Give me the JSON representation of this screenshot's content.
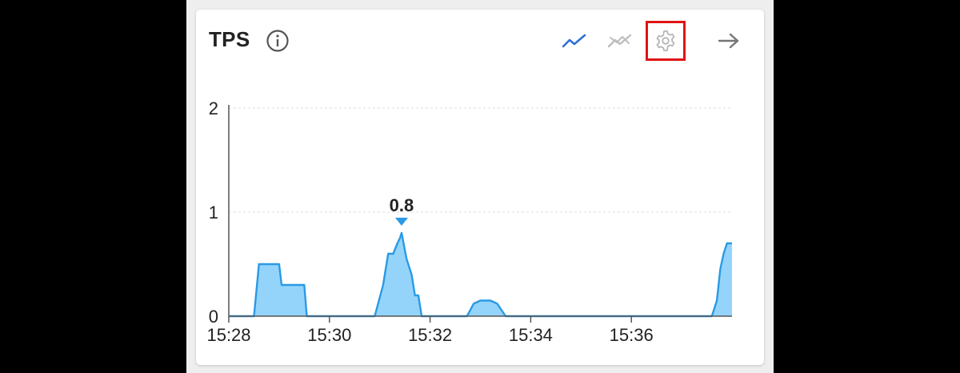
{
  "panel": {
    "title": "TPS",
    "icons": {
      "info": "info-circle-icon",
      "line_mode": "trend-line-icon",
      "compare_mode": "trend-compare-icon",
      "settings": "gear-icon",
      "open": "arrow-right-icon"
    },
    "colors": {
      "active_icon": "#2f6fd6",
      "inactive_icon": "#bdbdbd",
      "settings_highlight": "#e01414",
      "series_stroke": "#2a9ae6",
      "series_fill": "#8fd2fa"
    }
  },
  "chart_data": {
    "type": "area",
    "title": "",
    "xlabel": "",
    "ylabel": "",
    "ylim": [
      0,
      2
    ],
    "yticks": [
      "0",
      "1",
      "2"
    ],
    "xticks": [
      "15:28",
      "15:30",
      "15:32",
      "15:34",
      "15:36"
    ],
    "grid": true,
    "peak_label": "0.8",
    "series": [
      {
        "points": [
          [
            "15:28:00",
            0
          ],
          [
            "15:28:30",
            0
          ],
          [
            "15:28:36",
            0.5
          ],
          [
            "15:29:00",
            0.5
          ],
          [
            "15:29:03",
            0.3
          ],
          [
            "15:29:30",
            0.3
          ],
          [
            "15:29:33",
            0
          ],
          [
            "15:30:54",
            0
          ],
          [
            "15:31:04",
            0.3
          ],
          [
            "15:31:10",
            0.6
          ],
          [
            "15:31:16",
            0.6
          ],
          [
            "15:31:21",
            0.7
          ],
          [
            "15:31:24",
            0.75
          ],
          [
            "15:31:26",
            0.8
          ],
          [
            "15:31:32",
            0.55
          ],
          [
            "15:31:38",
            0.4
          ],
          [
            "15:31:42",
            0.2
          ],
          [
            "15:31:46",
            0.2
          ],
          [
            "15:31:50",
            0
          ],
          [
            "15:32:44",
            0
          ],
          [
            "15:32:52",
            0.12
          ],
          [
            "15:33:00",
            0.15
          ],
          [
            "15:33:12",
            0.15
          ],
          [
            "15:33:20",
            0.12
          ],
          [
            "15:33:30",
            0
          ],
          [
            "15:37:36",
            0
          ],
          [
            "15:37:42",
            0.15
          ],
          [
            "15:37:46",
            0.45
          ],
          [
            "15:37:50",
            0.6
          ],
          [
            "15:37:54",
            0.7
          ],
          [
            "15:38:00",
            0.7
          ]
        ]
      }
    ]
  }
}
